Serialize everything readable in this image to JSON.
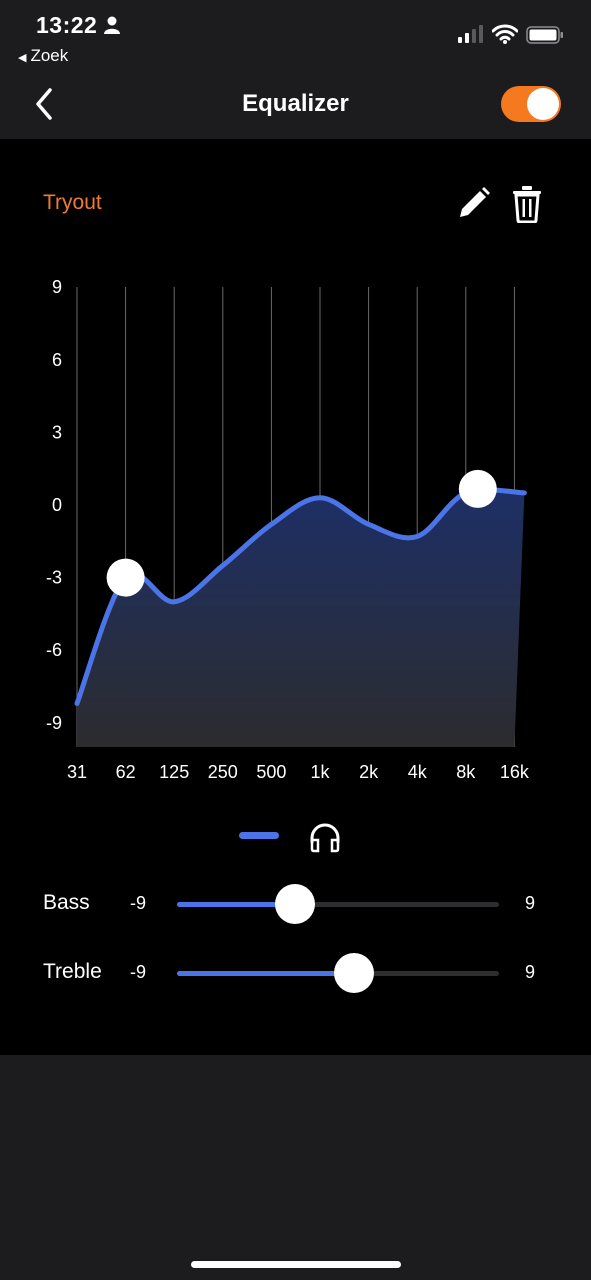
{
  "status_bar": {
    "time": "13:22",
    "back_app": "Zoek"
  },
  "nav": {
    "title": "Equalizer",
    "toggle_on": true,
    "accent": "#f5791f"
  },
  "preset": {
    "name": "Tryout",
    "color": "#f07a35"
  },
  "chart_data": {
    "type": "area",
    "categories": [
      "31",
      "62",
      "125",
      "250",
      "500",
      "1k",
      "2k",
      "4k",
      "8k",
      "16k"
    ],
    "values": [
      -8.2,
      -3,
      -4,
      -2.5,
      -0.8,
      0.3,
      -0.8,
      -1.3,
      0.5,
      0.5
    ],
    "yticks": [
      9,
      6,
      3,
      0,
      -3,
      -6,
      -9
    ],
    "ylim": [
      -10,
      9
    ],
    "control_points": [
      "62",
      "8k"
    ],
    "line_color": "#4a74e8",
    "grid": true
  },
  "sliders": {
    "bass": {
      "label": "Bass",
      "min": "-9",
      "max": "9",
      "value": -2.4
    },
    "treble": {
      "label": "Treble",
      "min": "-9",
      "max": "9",
      "value": 0.9
    }
  }
}
